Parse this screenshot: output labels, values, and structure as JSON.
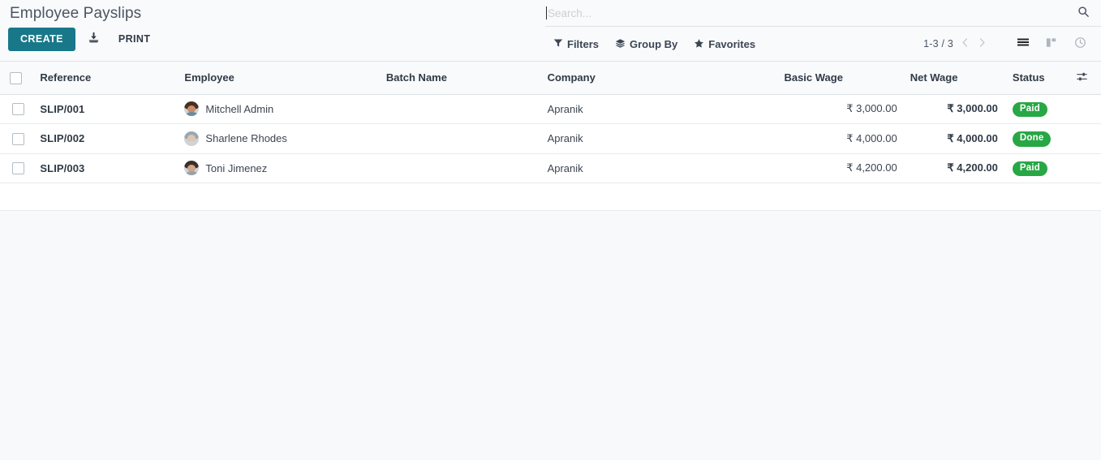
{
  "breadcrumb": {
    "title": "Employee Payslips"
  },
  "toolbar": {
    "create_label": "CREATE",
    "export_icon": "download-icon",
    "print_label": "PRINT"
  },
  "search": {
    "placeholder": "Search...",
    "value": "",
    "search_icon": "search-icon"
  },
  "searchpanel": {
    "filters_label": "Filters",
    "filters_icon": "filter-icon",
    "groupby_label": "Group By",
    "groupby_icon": "layers-icon",
    "favorites_label": "Favorites",
    "favorites_icon": "star-icon"
  },
  "pager": {
    "range": "1-3 / 3",
    "prev_icon": "chevron-left-icon",
    "next_icon": "chevron-right-icon"
  },
  "views": [
    {
      "name": "list",
      "icon": "list-view-icon",
      "active": true
    },
    {
      "name": "kanban",
      "icon": "kanban-view-icon",
      "active": false
    },
    {
      "name": "activity",
      "icon": "clock-view-icon",
      "active": false
    }
  ],
  "table": {
    "select_all_icon": "checkbox-unchecked",
    "optional_columns_icon": "sliders-icon",
    "columns": [
      "Reference",
      "Employee",
      "Batch Name",
      "Company",
      "Basic Wage",
      "Net Wage",
      "Status"
    ],
    "rows": [
      {
        "reference": "SLIP/001",
        "employee": "Mitchell Admin",
        "batch_name": "",
        "company": "Apranik",
        "basic_wage": "₹ 3,000.00",
        "net_wage": "₹ 3,000.00",
        "status": "Paid",
        "avatar_hair": "#4b2e1e",
        "avatar_face": "#c98d6b",
        "avatar_body": "#6f8a9c"
      },
      {
        "reference": "SLIP/002",
        "employee": "Sharlene Rhodes",
        "batch_name": "",
        "company": "Apranik",
        "basic_wage": "₹ 4,000.00",
        "net_wage": "₹ 4,000.00",
        "status": "Done",
        "avatar_hair": "#9aa7b1",
        "avatar_face": "#e0c4b4",
        "avatar_body": "#cdd4da"
      },
      {
        "reference": "SLIP/003",
        "employee": "Toni Jimenez",
        "batch_name": "",
        "company": "Apranik",
        "basic_wage": "₹ 4,200.00",
        "net_wage": "₹ 4,200.00",
        "status": "Paid",
        "avatar_hair": "#3a2f2a",
        "avatar_face": "#d3a487",
        "avatar_body": "#9aa2a8"
      }
    ]
  },
  "colors": {
    "primary": "#18788a",
    "badge_green": "#28a745",
    "panel_bg": "#f9fafb",
    "page_bg": "#f8f9fa"
  }
}
